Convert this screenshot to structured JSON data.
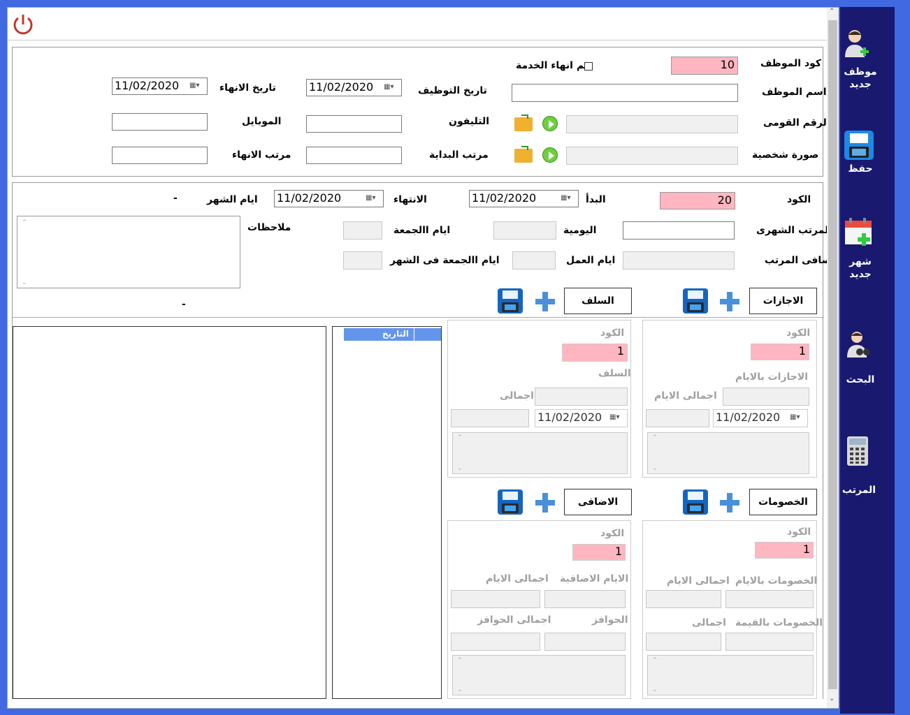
{
  "employee": {
    "code_label": "كود الموظف",
    "code_value": "10",
    "end_service_label": "تم انهاء الخدمة",
    "name_label": "اسم الموظف",
    "hire_date_label": "تاريخ التوظيف",
    "hire_date_value": "11/02/2020",
    "end_date_label": "تاريخ الانهاء",
    "end_date_value": "11/02/2020",
    "national_id_label": "الرقم القومى",
    "phone_label": "التليفون",
    "mobile_label": "الموبايل",
    "photo_label": "صورة شخصية",
    "start_salary_label": "مرتب البداية",
    "end_salary_label": "مرتب الانهاء"
  },
  "month": {
    "code_label": "الكود",
    "code_value": "20",
    "start_label": "البدأ",
    "start_value": "11/02/2020",
    "end_label": "الانتهاء",
    "end_value": "11/02/2020",
    "days_label": "ايام الشهر",
    "days_value": "-",
    "monthly_salary_label": "المرتب الشهرى",
    "daily_label": "اليومية",
    "fridays_label": "ايام االجمعة",
    "notes_label": "ملاحظات",
    "net_salary_label": "صافى المرتب",
    "work_days_label": "ايام العمل",
    "fridays_in_month_label": "ايام االجمعة فى الشهر",
    "dash_value": "-"
  },
  "grid": {
    "date_header": "التاريخ"
  },
  "leaves": {
    "button": "الاجازات",
    "code_label": "الكود",
    "code_value": "1",
    "days_label": "الاجازات بالايام",
    "total_days_label": "اجمالى الايام",
    "date_value": "11/02/2020"
  },
  "advances": {
    "button": "السلف",
    "code_label": "الكود",
    "code_value": "1",
    "advances_label": "السلف",
    "total_label": "اجمالى",
    "date_value": "11/02/2020"
  },
  "deductions": {
    "button": "الخصومات",
    "code_label": "الكود",
    "code_value": "1",
    "days_label": "الخصومات بالايام",
    "total_days_label": "اجمالى الايام",
    "value_label": "الخصومات بالقيمة",
    "total_label": "اجمالى"
  },
  "additions": {
    "button": "الاضافى",
    "code_label": "الكود",
    "code_value": "1",
    "extra_days_label": "الايام الاضافية",
    "total_days_label": "اجمالى الايام",
    "incentives_label": "الحوافز",
    "total_incentives_label": "اجمالى الحوافز"
  },
  "sidebar": {
    "new_employee": "موظف جديد",
    "save": "حفظ",
    "new_month": "شهر جديد",
    "search": "البحث",
    "salary": "المرتب"
  },
  "colors": {
    "frame": "#4169e1",
    "sidebar": "#191970",
    "pink": "#ffb6c1",
    "power_icon": "#c0392b"
  },
  "icons": [
    "power-icon",
    "checkbox-icon",
    "folder-open-icon",
    "play-icon",
    "plus-icon",
    "save-icon",
    "user-add-icon",
    "calendar-add-icon",
    "user-search-icon",
    "calculator-icon"
  ]
}
